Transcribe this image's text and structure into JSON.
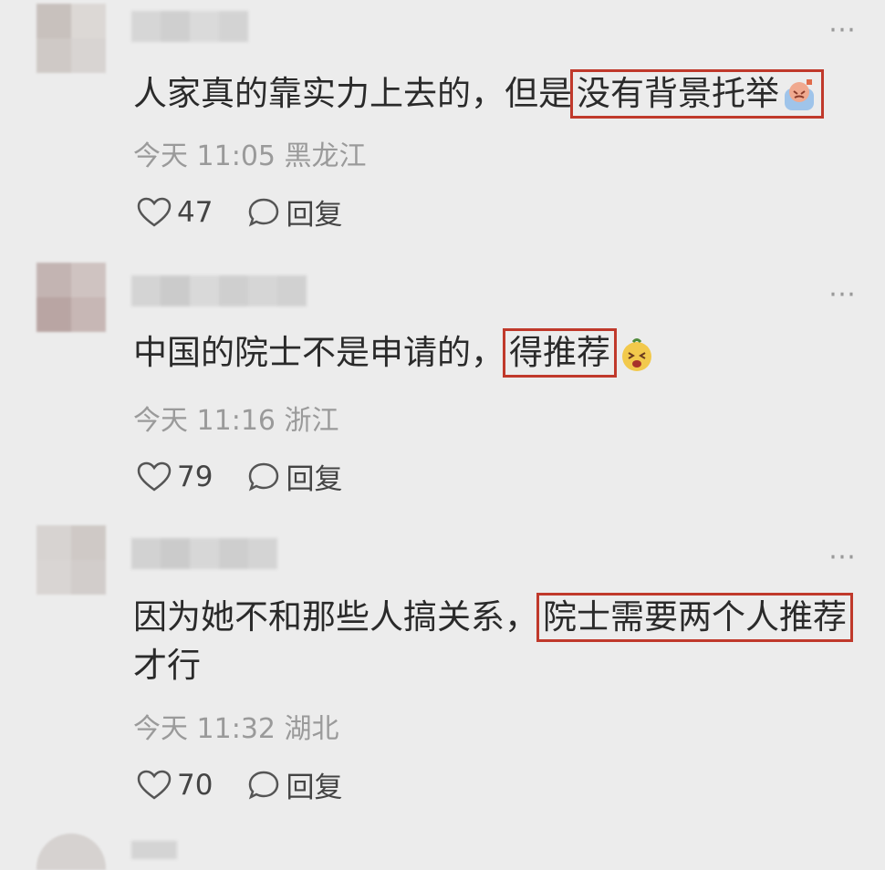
{
  "comments": [
    {
      "text_before": "人家真的靠实力上去的，但是",
      "highlight": "没有背景托举",
      "text_after": "",
      "emoji": "sweating-face-emoji",
      "time": "今天 11:05",
      "location": "黑龙江",
      "likes": "47",
      "reply_label": "回复",
      "avatar_colors": [
        "#c8c1bd",
        "#dcd8d5",
        "#cfc9c6",
        "#d8d4d2"
      ],
      "name_colors": [
        "#d6d6d6",
        "#cfcfcf",
        "#dadada",
        "#d3d3d3"
      ]
    },
    {
      "text_before": "中国的院士不是申请的，",
      "highlight": "得推荐",
      "text_after": "",
      "emoji": "laughing-face-emoji",
      "time": "今天 11:16",
      "location": "浙江",
      "likes": "79",
      "reply_label": "回复",
      "avatar_colors": [
        "#c3b4b2",
        "#cfc3c1",
        "#b9a5a3",
        "#c7b7b5"
      ],
      "name_colors": [
        "#d4d4d4",
        "#cbcbcb",
        "#d9d9d9",
        "#cfcfcf",
        "#d6d6d6",
        "#d1d1d1"
      ]
    },
    {
      "text_before": "因为她不和那些人搞关系，",
      "highlight": "院士需要两个人推荐",
      "text_after": "才行",
      "emoji": "",
      "time": "今天 11:32",
      "location": "湖北",
      "likes": "70",
      "reply_label": "回复",
      "avatar_colors": [
        "#d7d3d1",
        "#cfc9c6",
        "#d9d5d3",
        "#d2cdcb"
      ],
      "name_colors": [
        "#d2d2d2",
        "#cbcbcb",
        "#d7d7d7",
        "#cecece",
        "#d4d4d4"
      ]
    }
  ],
  "more_icon": "⋯",
  "colors": {
    "highlight_border": "#c0392b",
    "background": "#ececec"
  }
}
